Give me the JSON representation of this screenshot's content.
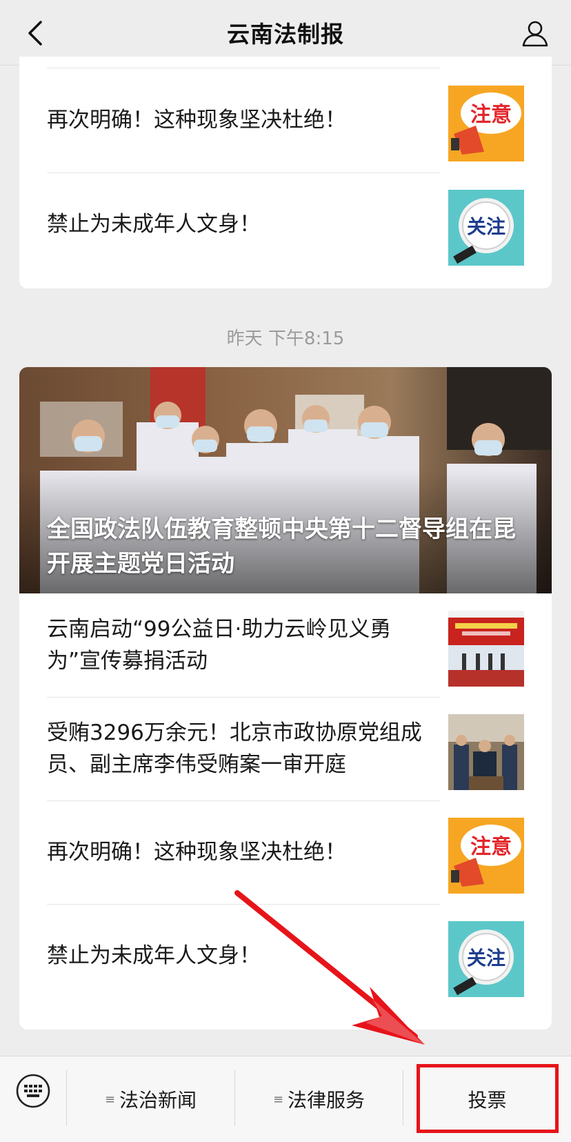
{
  "header": {
    "title": "云南法制报"
  },
  "card1": {
    "items": [
      {
        "title": "再次明确！这种现象坚决杜绝！",
        "thumb_label": "注意"
      },
      {
        "title": "禁止为未成年人文身！",
        "thumb_label": "关注"
      }
    ]
  },
  "timestamp": "昨天 下午8:15",
  "card2": {
    "hero": {
      "title": "全国政法队伍教育整顿中央第十二督导组在昆开展主题党日活动"
    },
    "items": [
      {
        "title": "云南启动“99公益日·助力云岭见义勇为”宣传募捐活动"
      },
      {
        "title": "受贿3296万余元！北京市政协原党组成员、副主席李伟受贿案一审开庭"
      },
      {
        "title": "再次明确！这种现象坚决杜绝！",
        "thumb_label": "注意"
      },
      {
        "title": "禁止为未成年人文身！",
        "thumb_label": "关注"
      }
    ]
  },
  "bottom_menu": {
    "items": [
      {
        "label": "法治新闻",
        "icon": "list-icon"
      },
      {
        "label": "法律服务",
        "icon": "list-icon"
      },
      {
        "label": "投票"
      }
    ]
  },
  "colors": {
    "accent_red": "#e6141a",
    "thumb_orange": "#f6a623",
    "thumb_teal": "#5cc7c9"
  }
}
